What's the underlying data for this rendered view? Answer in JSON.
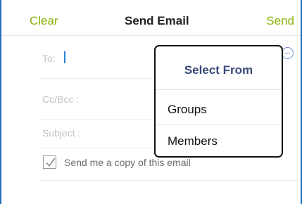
{
  "nav": {
    "clear_label": "Clear",
    "title": "Send Email",
    "send_label": "Send"
  },
  "form": {
    "to_label": "To:",
    "cc_label": "Cc/Bcc :",
    "subject_label": "Subject :",
    "copy_label": "Send me a copy of this email",
    "copy_checked": true
  },
  "popup": {
    "title": "Select From",
    "items": [
      {
        "label": "Groups"
      },
      {
        "label": "Members"
      }
    ]
  },
  "colors": {
    "accent_green": "#8bb10b",
    "popup_title": "#3a4b7a",
    "frame_blue": "#1f6fb5"
  },
  "icons": {
    "add": "plus-circle-icon",
    "check": "checkmark-icon"
  }
}
